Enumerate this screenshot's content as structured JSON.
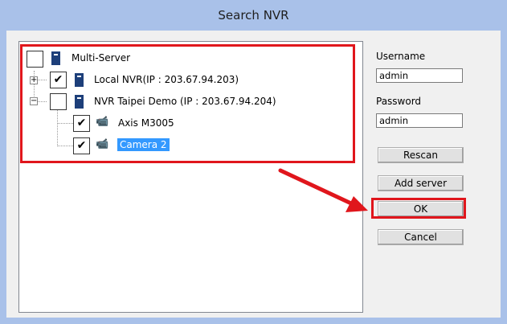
{
  "window": {
    "title": "Search NVR"
  },
  "tree": {
    "root": {
      "label": "Multi-Server",
      "checked": false
    },
    "servers": [
      {
        "label": "Local NVR(IP : 203.67.94.203)",
        "checked": true,
        "expander": "+"
      },
      {
        "label": "NVR Taipei Demo (IP : 203.67.94.204)",
        "checked": false,
        "expander": "−"
      }
    ],
    "cameras": [
      {
        "label": "Axis M3005",
        "checked": true
      },
      {
        "label": "Camera 2",
        "checked": true,
        "selected": true
      }
    ]
  },
  "form": {
    "username_label": "Username",
    "username_value": "admin",
    "password_label": "Password",
    "password_value": "admin"
  },
  "buttons": {
    "rescan": "Rescan",
    "add_server": "Add server",
    "ok": "OK",
    "cancel": "Cancel"
  },
  "colors": {
    "highlight": "#e0161c",
    "selection": "#3399ff",
    "titlebar": "#a9c1e9"
  },
  "icons": {
    "checked": "✔",
    "server": "server-icon",
    "camera": "camera-icon"
  }
}
